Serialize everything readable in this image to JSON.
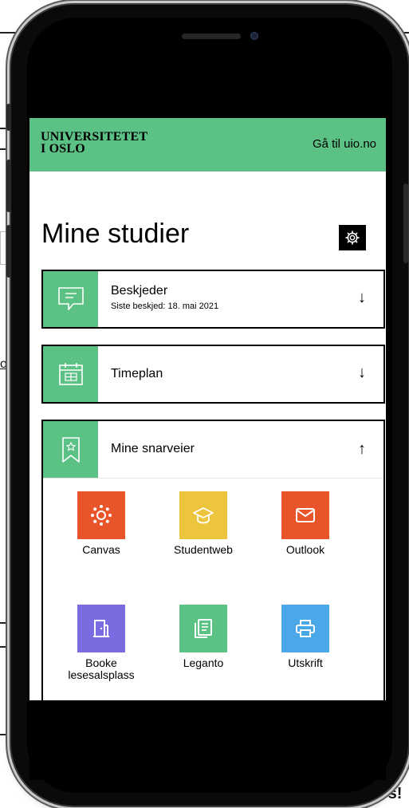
{
  "background": {
    "fragment_left": "oc",
    "fragment_bottom": "ies!"
  },
  "header": {
    "logo_line1": "UNIVERSITETET",
    "logo_line2": "I OSLO",
    "link_label": "Gå til uio.no"
  },
  "page": {
    "title": "Mine studier",
    "settings_icon": "gear-icon"
  },
  "cards": {
    "messages": {
      "title": "Beskjeder",
      "subtitle": "Siste beskjed: 18. mai 2021",
      "arrow": "↓",
      "icon": "message-icon"
    },
    "schedule": {
      "title": "Timeplan",
      "arrow": "↓",
      "icon": "calendar-icon"
    },
    "shortcuts": {
      "title": "Mine snarveier",
      "arrow": "↑",
      "icon": "bookmark-icon"
    }
  },
  "shortcuts": [
    {
      "label": "Canvas",
      "color": "#e9552b",
      "icon": "canvas-icon"
    },
    {
      "label": "Studentweb",
      "color": "#ecc53d",
      "icon": "graduation-cap-icon"
    },
    {
      "label": "Outlook",
      "color": "#e9552b",
      "icon": "mail-icon"
    },
    {
      "label": "Booke lesesalsplass",
      "color": "#7b6be0",
      "icon": "door-icon"
    },
    {
      "label": "Leganto",
      "color": "#5cc184",
      "icon": "reading-list-icon"
    },
    {
      "label": "Utskrift",
      "color": "#4aa8e8",
      "icon": "printer-icon"
    }
  ],
  "colors": {
    "accent_green": "#5cc184",
    "frame": "#0a0a0a"
  }
}
